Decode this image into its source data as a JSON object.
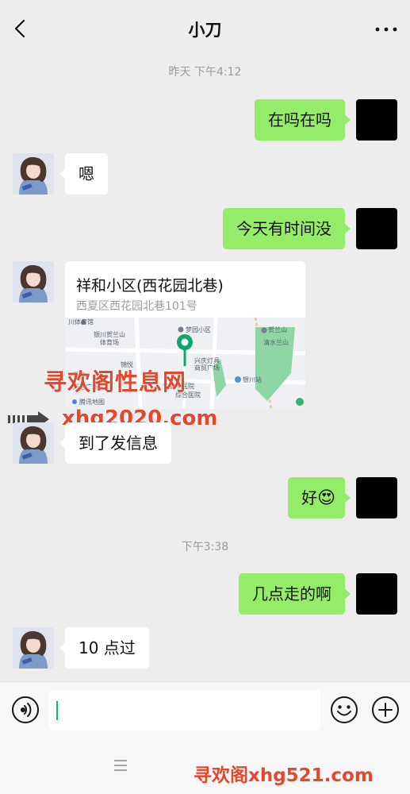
{
  "header": {
    "title": "小刀"
  },
  "messages": {
    "time1": "昨天 下午4:12",
    "m1": "在吗在吗",
    "m2": "嗯",
    "m3": "今天有时间没",
    "location": {
      "name": "祥和小区(西花园北巷)",
      "address": "西夏区西花园北巷101号",
      "map_source": "腾讯地图",
      "map_labels": [
        "川体育馆",
        "银川贺兰山",
        "体育场",
        "梦园小区",
        "贺兰山",
        "清水兰山",
        "兴庆灯具",
        "商贸广场",
        "银川站",
        "宁夏中医院",
        "综合医院",
        "万达广场",
        "锦悦",
        "百丰"
      ]
    },
    "m4": "到了发信息",
    "m5": "好",
    "m5_emoji": "😍",
    "time2": "下午3:38",
    "m6": "几点走的啊",
    "m7": "10 点过"
  },
  "watermarks": {
    "site_name": "寻欢阁性息网",
    "domain1": "xhg2020.com",
    "bottom": "寻欢阁xhg521.com"
  },
  "input": {
    "value": ""
  },
  "colors": {
    "my_bubble": "#95ec69",
    "their_bubble": "#ffffff",
    "background": "#ededed",
    "watermark": "#e2472f"
  }
}
